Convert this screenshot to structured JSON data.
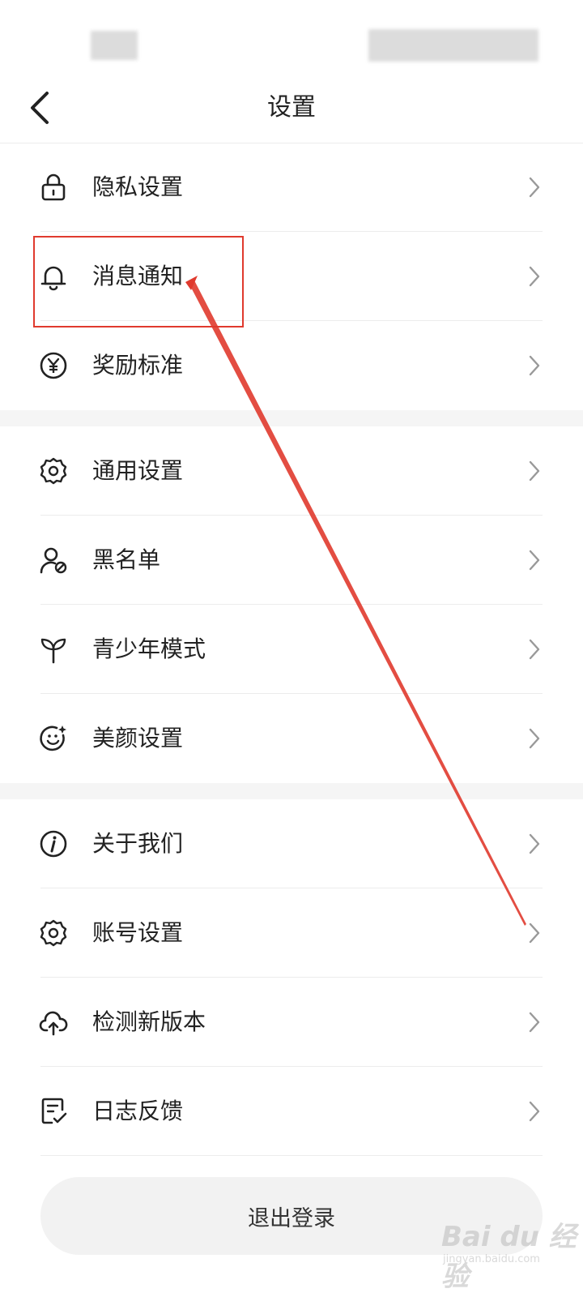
{
  "header": {
    "title": "设置"
  },
  "groups": [
    [
      {
        "label": "隐私设置",
        "icon": "lock-icon"
      },
      {
        "label": "消息通知",
        "icon": "bell-icon"
      },
      {
        "label": "奖励标准",
        "icon": "yen-coin-icon"
      }
    ],
    [
      {
        "label": "通用设置",
        "icon": "gear-icon"
      },
      {
        "label": "黑名单",
        "icon": "user-blocked-icon"
      },
      {
        "label": "青少年模式",
        "icon": "sprout-icon"
      },
      {
        "label": "美颜设置",
        "icon": "face-sparkle-icon"
      }
    ],
    [
      {
        "label": "关于我们",
        "icon": "info-icon"
      },
      {
        "label": "账号设置",
        "icon": "gear-icon"
      },
      {
        "label": "检测新版本",
        "icon": "cloud-upload-icon"
      },
      {
        "label": "日志反馈",
        "icon": "note-check-icon"
      }
    ]
  ],
  "logout": {
    "label": "退出登录"
  },
  "watermark": {
    "main": "Bai du 经验",
    "sub": "jingyan.baidu.com"
  },
  "colors": {
    "annotation": "#e03a2e",
    "divider": "#ececec",
    "section_gap": "#f5f5f5"
  }
}
